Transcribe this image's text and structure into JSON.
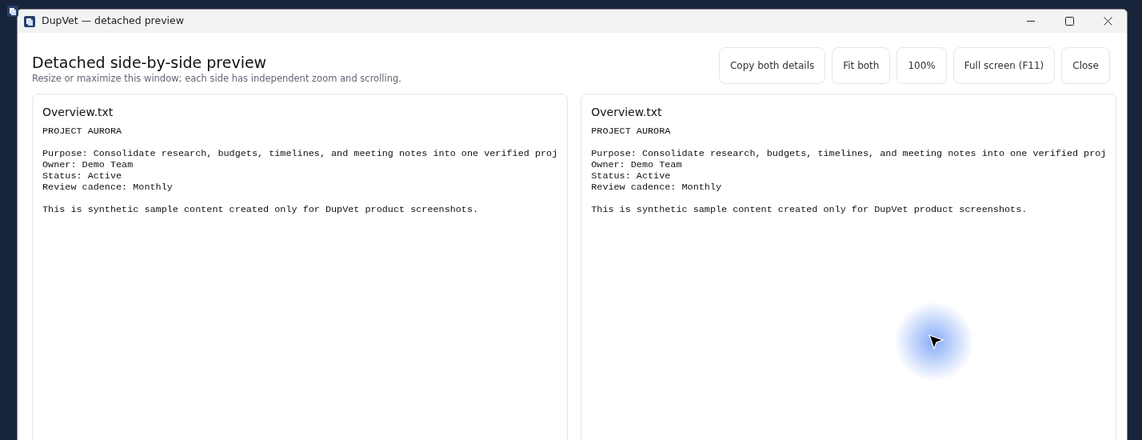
{
  "window": {
    "title": "DupVet — detached preview"
  },
  "header": {
    "title": "Detached side-by-side preview",
    "subtitle": "Resize or maximize this window; each side has independent zoom and scrolling."
  },
  "buttons": [
    "Copy both details",
    "Fit both",
    "100%",
    "Full screen (F11)",
    "Close"
  ],
  "panes": [
    {
      "filename": "Overview.txt",
      "blocks": [
        [
          "PROJECT AURORA"
        ],
        [
          "Purpose: Consolidate research, budgets, timelines, and meeting notes into one verified proj",
          "Owner: Demo Team",
          "Status: Active",
          "Review cadence: Monthly"
        ],
        [
          "This is synthetic sample content created only for DupVet product screenshots."
        ]
      ]
    },
    {
      "filename": "Overview.txt",
      "blocks": [
        [
          "PROJECT AURORA"
        ],
        [
          "Purpose: Consolidate research, budgets, timelines, and meeting notes into one verified proj",
          "Owner: Demo Team",
          "Status: Active",
          "Review cadence: Monthly"
        ],
        [
          "This is synthetic sample content created only for DupVet product screenshots."
        ]
      ]
    }
  ]
}
